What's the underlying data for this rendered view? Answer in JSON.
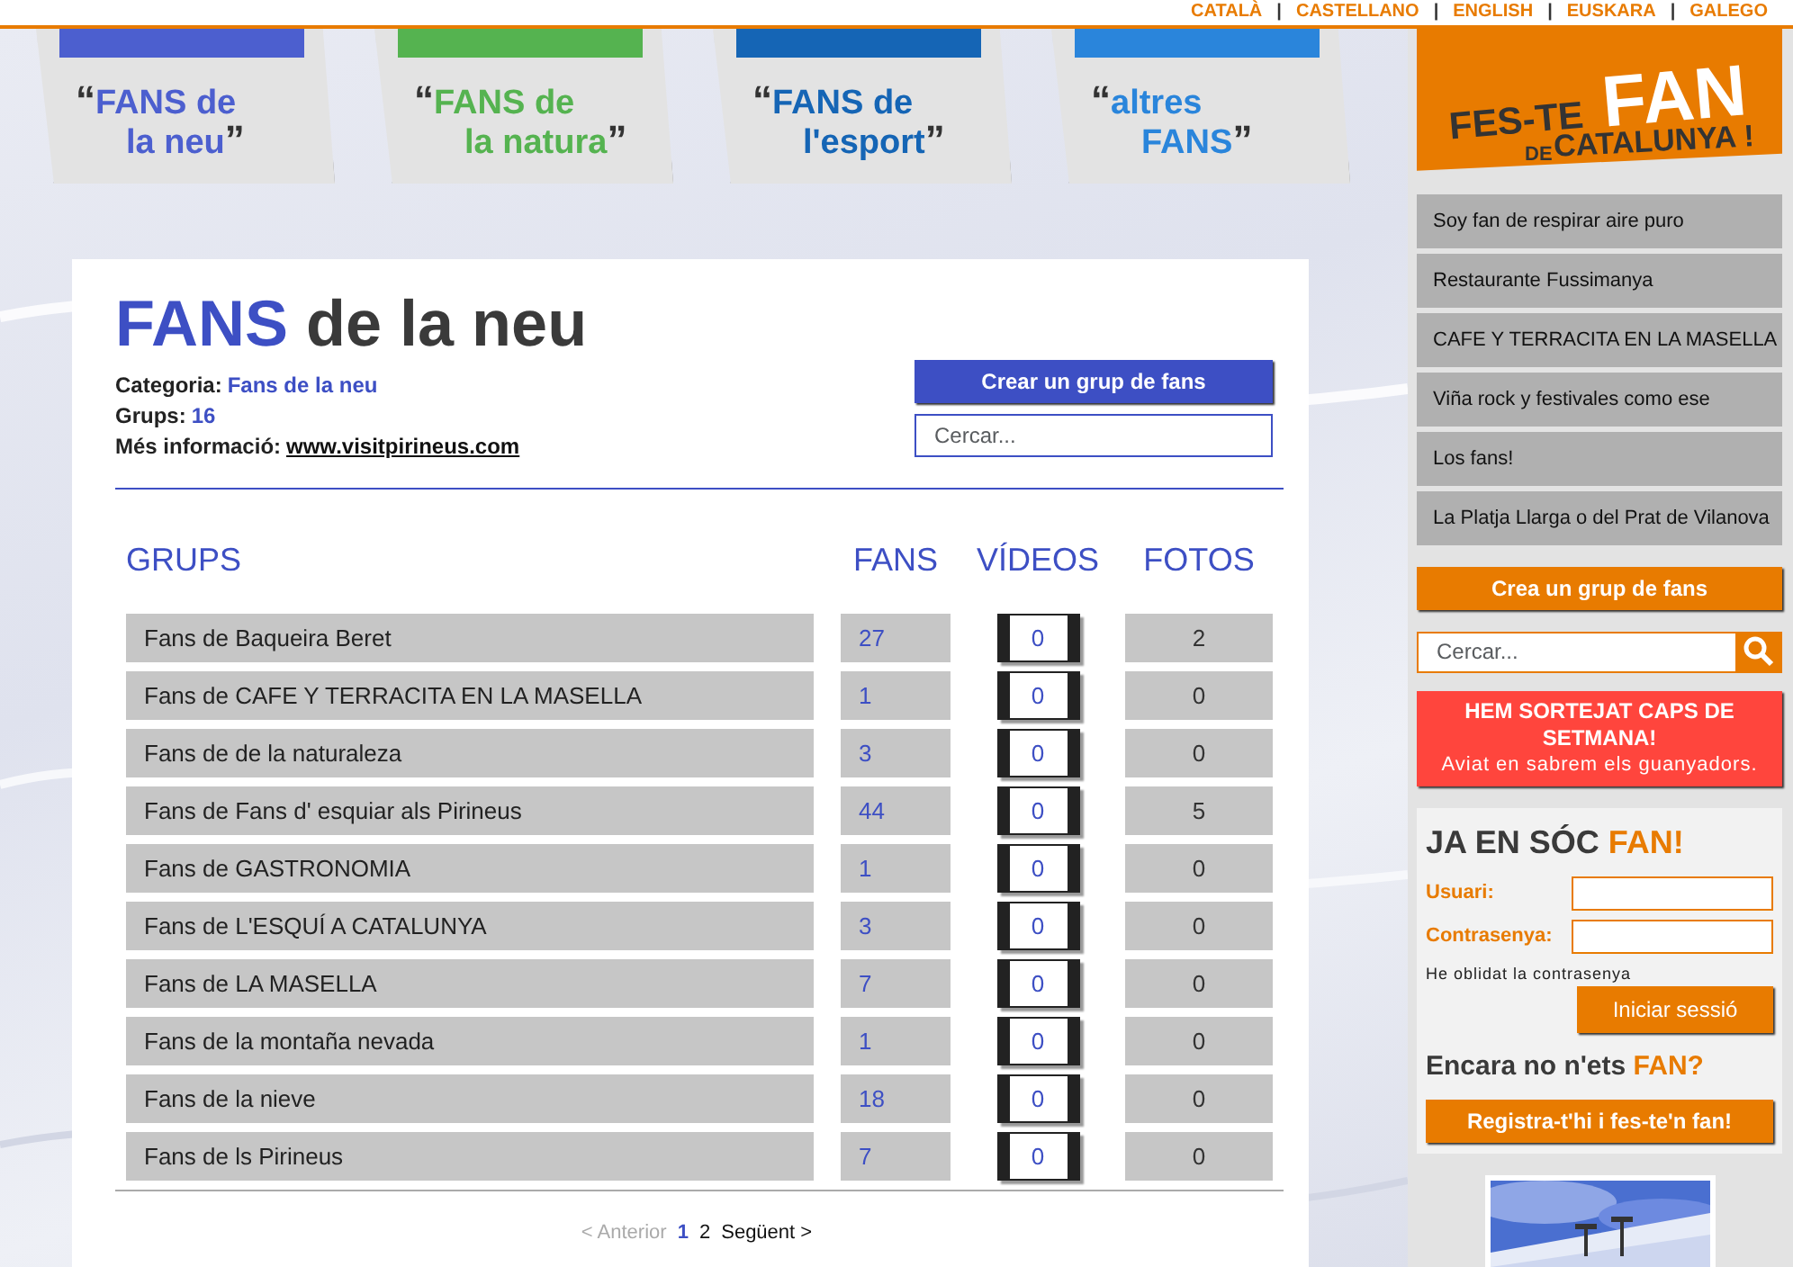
{
  "languages": [
    {
      "label": "CATALÀ"
    },
    {
      "label": "CASTELLANO"
    },
    {
      "label": "ENGLISH"
    },
    {
      "label": "EUSKARA"
    },
    {
      "label": "GALEGO"
    }
  ],
  "language_separator": "|",
  "category_tabs": [
    {
      "quote_open": "“",
      "line1": "FANS de",
      "line2": "la neu",
      "quote_close": "”",
      "color": "#4c5fcf"
    },
    {
      "quote_open": "“",
      "line1": "FANS de",
      "line2": "la natura",
      "quote_close": "”",
      "color": "#55b350"
    },
    {
      "quote_open": "“",
      "line1": "FANS de",
      "line2": "l'esport",
      "quote_close": "”",
      "color": "#1565b5"
    },
    {
      "quote_open": "“",
      "line1": "altres",
      "line2": "FANS",
      "quote_close": "”",
      "color": "#2a85db"
    }
  ],
  "page": {
    "title_accent": "FANS",
    "title_rest": "de la neu",
    "info": [
      {
        "label": "Categoria:",
        "value": "Fans de la neu",
        "kind": "accent"
      },
      {
        "label": "Grups:",
        "value": "16",
        "kind": "accent"
      },
      {
        "label": "Més informació:",
        "value": "www.visitpirineus.com",
        "kind": "link"
      }
    ],
    "create_button": "Crear un grup de fans",
    "search": {
      "placeholder": "Cercar..."
    }
  },
  "table": {
    "columns": [
      "GRUPS",
      "FANS",
      "VÍDEOS",
      "FOTOS"
    ],
    "rows": [
      {
        "group": "Fans de Baqueira Beret",
        "fans": "27",
        "videos": "0",
        "photos": "2"
      },
      {
        "group": "Fans de CAFE Y TERRACITA EN LA MASELLA",
        "fans": "1",
        "videos": "0",
        "photos": "0"
      },
      {
        "group": "Fans de de la naturaleza",
        "fans": "3",
        "videos": "0",
        "photos": "0"
      },
      {
        "group": "Fans de Fans d' esquiar als Pirineus",
        "fans": "44",
        "videos": "0",
        "photos": "5"
      },
      {
        "group": "Fans de GASTRONOMIA",
        "fans": "1",
        "videos": "0",
        "photos": "0"
      },
      {
        "group": "Fans de L'ESQUÍ A CATALUNYA",
        "fans": "3",
        "videos": "0",
        "photos": "0"
      },
      {
        "group": "Fans de LA MASELLA",
        "fans": "7",
        "videos": "0",
        "photos": "0"
      },
      {
        "group": "Fans de la montaña nevada",
        "fans": "1",
        "videos": "0",
        "photos": "0"
      },
      {
        "group": "Fans de la nieve",
        "fans": "18",
        "videos": "0",
        "photos": "0"
      },
      {
        "group": "Fans de ls Pirineus",
        "fans": "7",
        "videos": "0",
        "photos": "0"
      }
    ]
  },
  "pagination": {
    "previous": {
      "label": "< Anterior",
      "disabled": true
    },
    "pages": [
      {
        "label": "1",
        "selected": true
      },
      {
        "label": "2",
        "selected": false
      }
    ],
    "next": {
      "label": "Següent >",
      "disabled": false
    }
  },
  "sidebar": {
    "logo": {
      "line1": "FES-TE",
      "big": "FAN",
      "line2": "DE",
      "line3": "CATALUNYA !"
    },
    "groups": [
      "Soy fan de respirar aire puro",
      "Restaurante Fussimanya",
      "CAFE Y TERRACITA EN LA MASELLA",
      "Viña rock y festivales como ese",
      "Los fans!",
      "La Platja Llarga o del Prat de Vilanova"
    ],
    "create_button": "Crea un grup de fans",
    "search": {
      "placeholder": "Cercar..."
    },
    "banner": {
      "title": "HEM SORTEJAT CAPS DE SETMANA!",
      "subtitle": "Aviat en sabrem els guanyadors."
    },
    "login": {
      "heading": "JA EN SÓC",
      "heading_accent": "FAN!",
      "user_label": "Usuari:",
      "password_label": "Contrasenya:",
      "forgot": "He oblidat la contrasenya",
      "submit": "Iniciar sessió",
      "register_heading": "Encara no n'ets",
      "register_accent": "FAN?",
      "register_button": "Registra-t'hi i fes-te'n fan!"
    }
  }
}
